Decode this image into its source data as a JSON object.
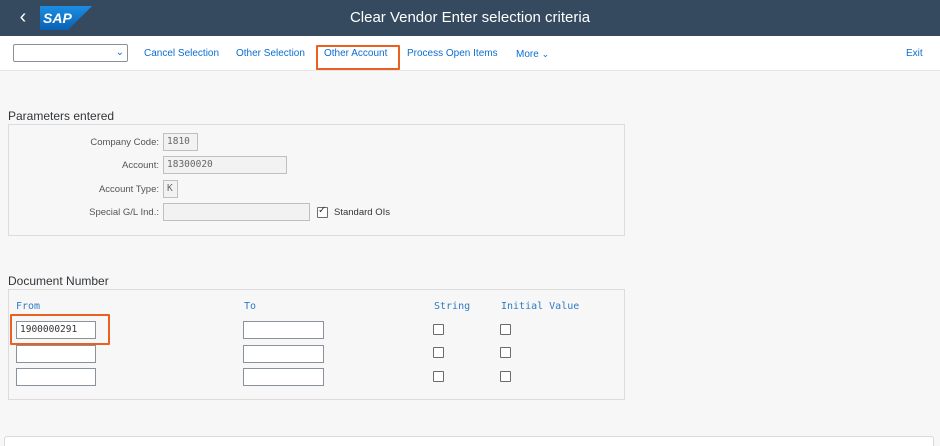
{
  "shell": {
    "title": "Clear Vendor Enter selection criteria",
    "logo_text": "SAP",
    "back_icon": "chevron-left-icon",
    "colors": {
      "shell_bg": "#354a5f",
      "logo_blue": "#0a6ed1",
      "accent_link": "#0a6ed1",
      "highlight": "#ea6020"
    }
  },
  "toolbar": {
    "dropdown_value": "",
    "cancel_selection": "Cancel Selection",
    "other_selection": "Other Selection",
    "other_account": "Other Account",
    "process_open_items": "Process Open Items",
    "more": "More",
    "exit": "Exit"
  },
  "parameters": {
    "title": "Parameters entered",
    "company_code_label": "Company Code:",
    "company_code_value": "1810",
    "account_label": "Account:",
    "account_value": "18300020",
    "account_type_label": "Account Type:",
    "account_type_value": "K",
    "special_gl_label": "Special G/L Ind.:",
    "special_gl_value": "",
    "standard_ois_label": "Standard OIs",
    "standard_ois_checked": true
  },
  "document_number": {
    "title": "Document Number",
    "col_from": "From",
    "col_to": "To",
    "col_string": "String",
    "col_initial_value": "Initial Value",
    "rows": [
      {
        "from": "1900000291",
        "to": "",
        "string": false,
        "initial_value": false
      },
      {
        "from": "",
        "to": "",
        "string": false,
        "initial_value": false
      },
      {
        "from": "",
        "to": "",
        "string": false,
        "initial_value": false
      }
    ]
  }
}
